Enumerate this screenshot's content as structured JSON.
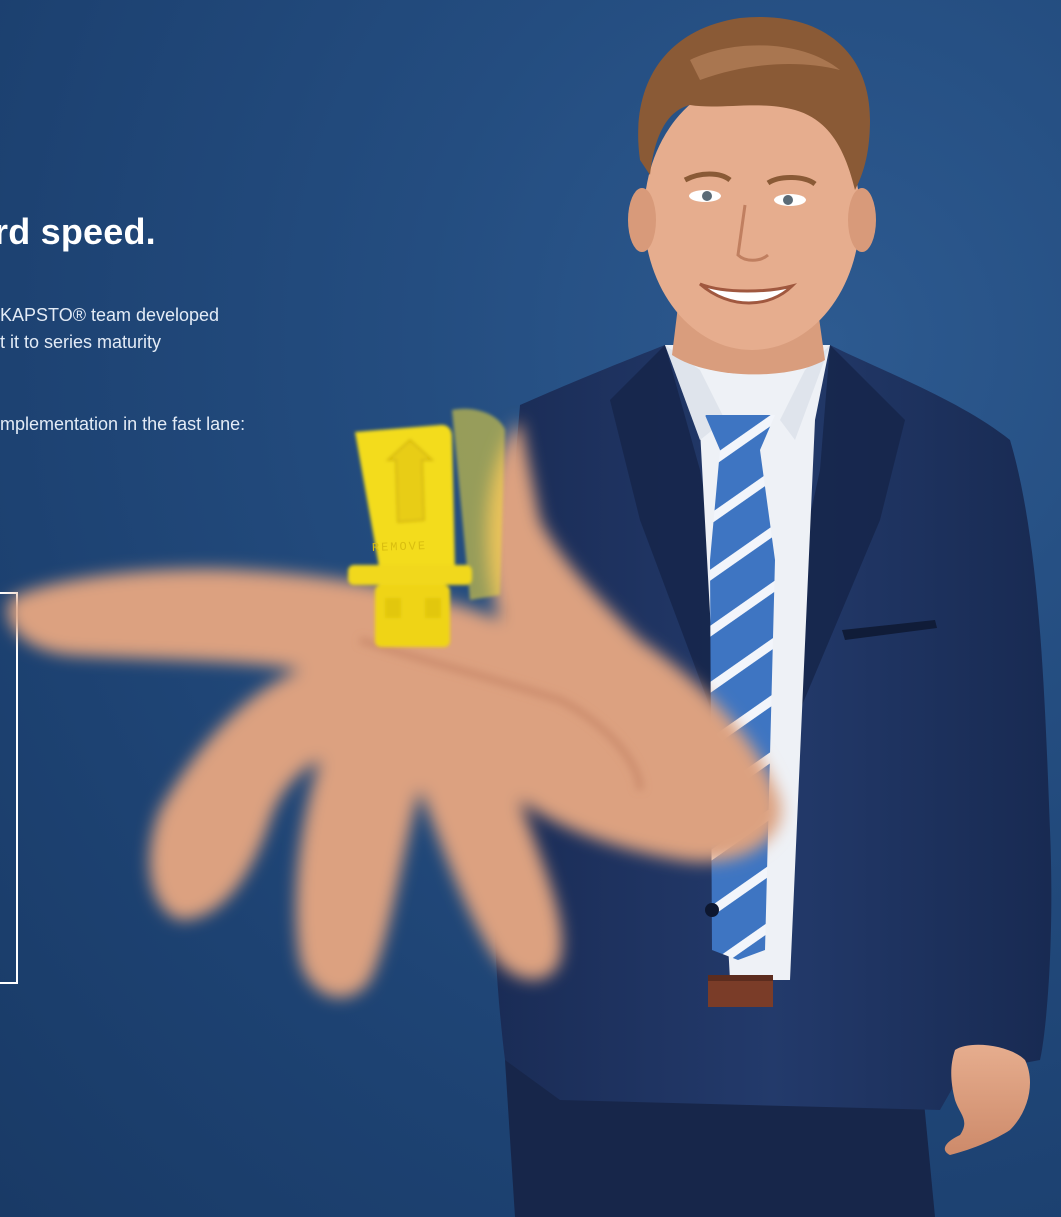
{
  "headline": "rd speed.",
  "body": {
    "line1": "KAPSTO® team developed",
    "line2": "t it to series maturity",
    "line3": "mplementation in the fast lane:"
  },
  "product": {
    "label": "REMOVE",
    "color": "#f3dc1c"
  },
  "colors": {
    "background": "#234a7c",
    "suit": "#1d2f5a",
    "tie": "#3d74c0"
  }
}
